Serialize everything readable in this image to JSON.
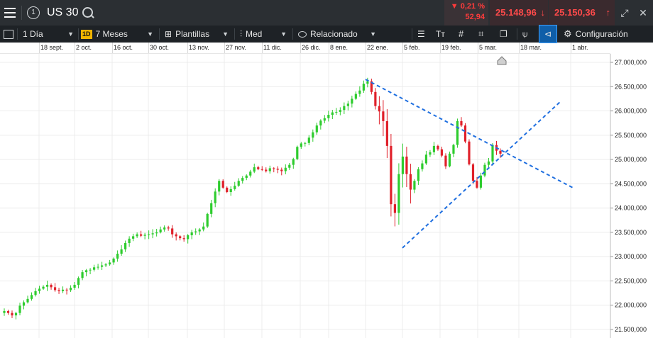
{
  "header": {
    "menu_icon": "hamburger-icon",
    "info_icon": "info-circle-icon",
    "instrument": "US 30",
    "search_icon": "search-icon",
    "change_pct": "▼ 0,21 %",
    "change_abs": "52,94",
    "sell_price": "25.148,96",
    "buy_price": "25.150,36",
    "expand_icon": "expand-icon"
  },
  "toolbar": {
    "interval": "1 Día",
    "period_badge": "1D",
    "period": "7 Meses",
    "templates": "Plantillas",
    "chart_style": "Med",
    "related": "Relacionado",
    "settings": "Configuración"
  },
  "colors": {
    "up": "#2ecc2e",
    "down": "#e0202a",
    "trend": "#1f6fe0",
    "accent": "#f0b400"
  },
  "chart_data": {
    "type": "candlestick",
    "title": "",
    "xlabel": "",
    "ylabel": "",
    "x_ticks": [
      "18 sept.",
      "2 oct.",
      "16 oct.",
      "30 oct.",
      "13 nov.",
      "27 nov.",
      "11 dic.",
      "26 dic.",
      "8 ene.",
      "22 ene.",
      "5 feb.",
      "19 feb.",
      "5 mar.",
      "18 mar.",
      "1 abr."
    ],
    "y_ticks": [
      "27.000,000",
      "26.500,000",
      "26.000,000",
      "25.500,000",
      "25.000,000",
      "24.500,000",
      "24.000,000",
      "23.500,000",
      "23.000,000",
      "22.500,000",
      "22.000,000",
      "21.500,000"
    ],
    "ylim": [
      21500,
      27000
    ],
    "closes": [
      21880,
      21840,
      21790,
      21840,
      21990,
      22060,
      22130,
      22210,
      22290,
      22340,
      22380,
      22420,
      22370,
      22310,
      22290,
      22320,
      22310,
      22360,
      22420,
      22560,
      22680,
      22720,
      22730,
      22780,
      22790,
      22820,
      22840,
      22880,
      22960,
      23060,
      23150,
      23280,
      23370,
      23420,
      23460,
      23430,
      23450,
      23460,
      23480,
      23500,
      23560,
      23600,
      23580,
      23460,
      23420,
      23380,
      23360,
      23440,
      23500,
      23520,
      23560,
      23620,
      23880,
      24100,
      24340,
      24560,
      24420,
      24330,
      24390,
      24460,
      24560,
      24620,
      24670,
      24750,
      24840,
      24800,
      24790,
      24760,
      24820,
      24810,
      24790,
      24760,
      24830,
      24890,
      25010,
      25260,
      25330,
      25340,
      25450,
      25560,
      25700,
      25800,
      25850,
      25920,
      25970,
      25980,
      26020,
      26100,
      26150,
      26250,
      26350,
      26420,
      26560,
      26610,
      26390,
      26100,
      25990,
      25790,
      25280,
      24080,
      23900,
      24700,
      25060,
      24700,
      24380,
      24560,
      24800,
      24920,
      25100,
      25150,
      25280,
      25210,
      25080,
      24860,
      25120,
      25300,
      25790,
      25700,
      25370,
      24900,
      24560,
      24420,
      24670,
      24890,
      24960,
      25300,
      25180,
      25120
    ],
    "trendlines": [
      {
        "name": "",
        "points": [
          [
            "22 ene.",
            26650
          ],
          [
            "18 mar.",
            25000
          ]
        ]
      },
      {
        "name": "",
        "points": [
          [
            "5 feb.",
            23180
          ],
          [
            "18 mar.",
            25400
          ]
        ]
      }
    ],
    "grid": true
  }
}
